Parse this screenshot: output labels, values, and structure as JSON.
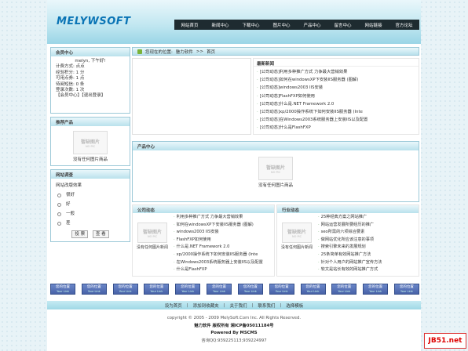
{
  "logo": "MELYWSOFT",
  "nav": [
    "网站首页",
    "新闻中心",
    "下载中心",
    "图片中心",
    "产品中心",
    "留言中心",
    "网站链接",
    "官方论坛"
  ],
  "member": {
    "title": "会员中心",
    "hello": "melyn, 下午好!",
    "lines": [
      "计费方式: 点点",
      "经验积分: 1 分",
      "可用点券: 1 点",
      "待阅短信: 0 条",
      "登录次数: 1 次",
      "【会员中心】【退出登录】"
    ]
  },
  "recommend": {
    "title": "推荐产品",
    "img_text": "暂缺图片",
    "img_sub": "NO PIC",
    "caption": "没有任何图片商品"
  },
  "poll": {
    "title": "网站调查",
    "question": "网站改版效果",
    "options": [
      "很好",
      "好",
      "一般",
      "差"
    ],
    "vote": "投 票",
    "view": "查 看"
  },
  "breadcrumb": {
    "prefix": "您现在的位置:",
    "site": "魅力软件",
    "sep": ">>",
    "page": "首页"
  },
  "news": {
    "title": "最新新闻",
    "items": [
      "[公司动态]利用多种推广方式 力争最大营销效果",
      "[公司动态]如何在windowsXP下安装IIS服务器 (图解)",
      "[公司动态]windows2003 IIS安装",
      "[公司动态]FlashFXP如何使用",
      "[公司动态]什么是.NET Framework 2.0",
      "[公司动态]xp/2000操作系统下如何安装IIS服务器 (Inte",
      "[公司动态]在Windows2003系统服务器上安装IIS以及配置",
      "[公司动态]什么是FlashFXP"
    ]
  },
  "products": {
    "title": "产品中心",
    "img_text": "暂缺图片",
    "img_sub": "NO PIC",
    "caption": "没有任何图片商品"
  },
  "company": {
    "title": "公司动态",
    "img_text": "暂缺图片",
    "img_sub": "NO PIC",
    "caption": "没有任何图片新闻",
    "items": [
      "利用多种推广方式 力争最大营销效果",
      "如何在windowsXP下安装IIS服务器 (图解)",
      "windows2003 IIS安装",
      "FlashFXP如何使用",
      "什么是.NET Framework 2.0",
      "xp/2000操作系统下如何安装IIS服务器 (Inte",
      "在Windows2003系统服务器上安装IIS以及配置",
      "什么是FlashFXP"
    ]
  },
  "industry": {
    "title": "行业动态",
    "img_text": "暂缺图片",
    "img_sub": "NO PIC",
    "caption": "没有任何图片新闻",
    "items": [
      "25种经典方案之网站推广",
      "网站运营发展所要经历的推广",
      "seo所需的六项综合要素",
      "做网站优化所应该注意的事项",
      "搜索引擎未来的发展规划",
      "25条简单有效网站推广方法",
      "针对个人用户的网站推广宣传方法",
      "软文是站长有效的网站推广方式"
    ]
  },
  "links": {
    "label": "您的位置",
    "sub": "Your Link",
    "count": 12
  },
  "footnav": [
    "设为首页",
    "添加到收藏夹",
    "关于我们",
    "联系我们",
    "选择模板"
  ],
  "footer": {
    "copyright": "copyright © 2005 - 2009 MelySoft.Com Inc. All Rights Reserved.",
    "owner": "魅力软件 版权所有 湘ICP备05011184号",
    "powered": "Powered By MSCMS",
    "qq": "咨询QQ:939225113;939224997"
  },
  "badge": "JB51.net"
}
